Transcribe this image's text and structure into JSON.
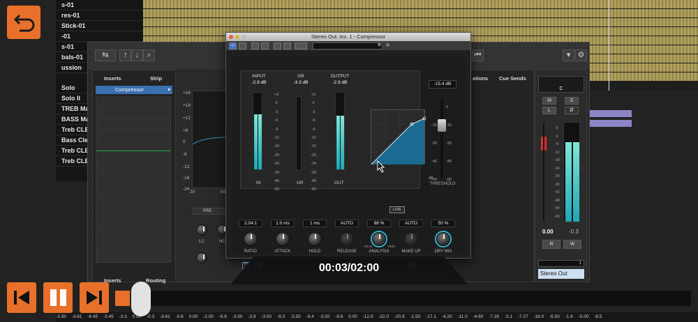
{
  "tracks": [
    "s-01",
    "res-01",
    "Stick-01",
    "-01",
    "s-01",
    "bals-01",
    "ussion"
  ],
  "insert_names": [
    "Solo",
    "Solo II",
    "TREB Ma",
    "BASS Ma",
    "Treb CLE",
    "Bass Clea",
    "Treb CLE",
    "Treb CLE"
  ],
  "mixer": {
    "inserts_tab": "Inserts",
    "strip_tab": "Strip",
    "inserts_bottom_tab": "Inserts",
    "routing_tab": "Routing",
    "selected_insert": "Compressor",
    "pre_label": "PRE",
    "lc_label": "LC",
    "hc_label": "HC",
    "eq_scale": [
      "+24",
      "+18",
      "+12",
      "+6",
      "0",
      "-6",
      "-12",
      "-18",
      "-24"
    ],
    "eq_x_axis": [
      "20",
      "50"
    ],
    "right_tabs": [
      "ations",
      "Cue Sends"
    ],
    "master_name": "Stereo Out",
    "master_vol": "0.00",
    "master_peak": "-0.3",
    "master_meter_scale": [
      "6",
      "0",
      "-6",
      "-12",
      "-18",
      "-24",
      "-30",
      "-36",
      "-42",
      "-48",
      "-54",
      "-60"
    ],
    "ch_buttons": [
      "M",
      "S",
      "L",
      "R",
      "W"
    ],
    "ch_letter": "C",
    "master_count": "1"
  },
  "plugin": {
    "title": "Stereo Out: Ins. 1 - Compressor",
    "input_label": "INPUT",
    "input_value": "-2.9 dB",
    "gr_label": "GR",
    "gr_value": "-3.3 dB",
    "output_label": "OUTPUT",
    "output_value": "-2.9 dB",
    "meter_scale": [
      "+3",
      "0",
      "-3",
      "-6",
      "-9",
      "-12",
      "-16",
      "-20",
      "-24",
      "-30",
      "-40",
      "-60"
    ],
    "gr_scale": [
      "+3",
      "0",
      "-3",
      "-6",
      "-9",
      "-12",
      "-16",
      "-20",
      "-24",
      "-30",
      "-40",
      "-60"
    ],
    "footer_in": "IN",
    "footer_gr": "GR",
    "footer_out": "OUT",
    "live_label": "LIVE",
    "threshold_value": "-15.4 dB",
    "threshold_scale": [
      "-15",
      "-30",
      "-45",
      "-60"
    ],
    "threshold_scale_right": [
      "0",
      "-15",
      "-30",
      "-45",
      "-60"
    ],
    "threshold_unit": "dB",
    "threshold_label": "THRESHOLD",
    "params": [
      {
        "name": "RATIO",
        "value": "2.04:1"
      },
      {
        "name": "ATTACK",
        "value": "1.0 ms"
      },
      {
        "name": "HOLD",
        "value": "1 ms"
      },
      {
        "name": "RELEASE",
        "value": "AUTO"
      },
      {
        "name": "ANALYSIS",
        "value": "88 %"
      },
      {
        "name": "MAKE UP",
        "value": "AUTO"
      },
      {
        "name": "DRY MIX",
        "value": "50 %"
      }
    ],
    "analysis_left": "PEAK",
    "analysis_right": "RMS",
    "auto_release_btn": "AR",
    "auto_makeup_btn": "AM",
    "hold_btn": "H",
    "input_level": 0.72,
    "output_level": 0.7,
    "gr_level": 0.0
  },
  "player": {
    "current_time": "00:03",
    "total_time": "02:00",
    "timecode": "00:03/02:00",
    "progress": 0.025
  },
  "bottom_values": "-3.50 -3.61 -6.45 -3.45 -3.3 0.00 -0.3 -3.61 -0.6 0.00 -2.00 -6.8 -3.50 -3.9 -3.50 -8.3 -3.50 -9.4 -3.50 -6.6 0.00 -12.9 -22.0 -20.8 -1.50 -17.1 -4.20 -11.0 -4.60 -7.26 -3.1 -7.27 -16.0 -6.50 -1.6 -5.00 -8.5"
}
